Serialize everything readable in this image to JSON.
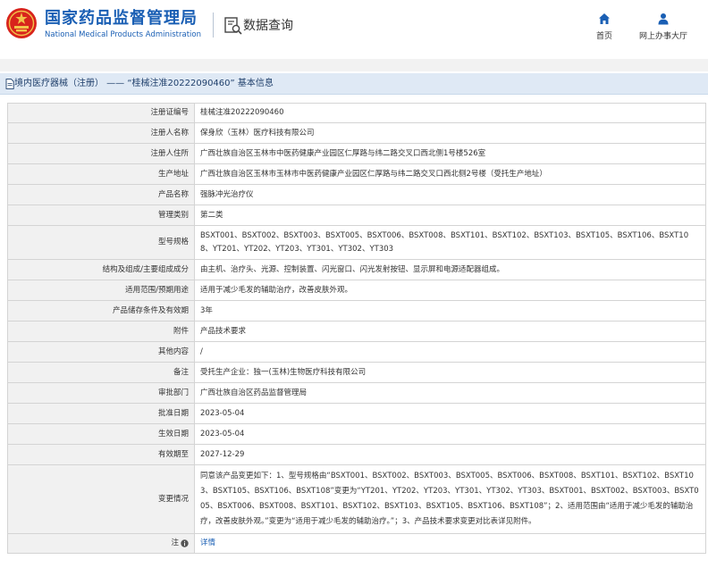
{
  "header": {
    "site_name_cn": "国家药品监督管理局",
    "site_name_en": "National Medical Products Administration",
    "section_title": "数据查询",
    "nav": [
      {
        "label": "首页",
        "icon": "home-icon"
      },
      {
        "label": "网上办事大厅",
        "icon": "user-icon"
      }
    ]
  },
  "colors": {
    "brand": "#1a5fb4",
    "title_bar_bg": "#dfe9f5",
    "label_cell_bg": "#f1f1f1",
    "logo_red": "#d8241c"
  },
  "title_bar": {
    "text": "境内医疗器械（注册） —— “桂械注准20222090460” 基本信息"
  },
  "rows": [
    {
      "label": "注册证编号",
      "value": "桂械注准20222090460"
    },
    {
      "label": "注册人名称",
      "value": "保身欣（玉林）医疗科技有限公司"
    },
    {
      "label": "注册人住所",
      "value": "广西壮族自治区玉林市中医药健康产业园区仁厚路与纬二路交叉口西北侧1号楼526室"
    },
    {
      "label": "生产地址",
      "value": "广西壮族自治区玉林市玉林市中医药健康产业园区仁厚路与纬二路交叉口西北侧2号楼（受托生产地址）"
    },
    {
      "label": "产品名称",
      "value": "强脉冲光治疗仪"
    },
    {
      "label": "管理类别",
      "value": "第二类"
    },
    {
      "label": "型号规格",
      "value": "BSXT001、BSXT002、BSXT003、BSXT005、BSXT006、BSXT008、BSXT101、BSXT102、BSXT103、BSXT105、BSXT106、BSXT108、YT201、YT202、YT203、YT301、YT302、YT303"
    },
    {
      "label": "结构及组成/主要组成成分",
      "value": "由主机、治疗头、光源、控制装置、闪光窗口、闪光发射按钮、显示屏和电源适配器组成。"
    },
    {
      "label": "适用范围/预期用途",
      "value": "适用于减少毛发的辅助治疗，改善皮肤外观。"
    },
    {
      "label": "产品储存条件及有效期",
      "value": "3年"
    },
    {
      "label": "附件",
      "value": "产品技术要求"
    },
    {
      "label": "其他内容",
      "value": "/"
    },
    {
      "label": "备注",
      "value": "受托生产企业：独一(玉林)生物医疗科技有限公司"
    },
    {
      "label": "审批部门",
      "value": "广西壮族自治区药品监督管理局"
    },
    {
      "label": "批准日期",
      "value": "2023-05-04"
    },
    {
      "label": "生效日期",
      "value": "2023-05-04"
    },
    {
      "label": "有效期至",
      "value": "2027-12-29"
    },
    {
      "label": "变更情况",
      "value": "同意该产品变更如下：1、型号规格由“BSXT001、BSXT002、BSXT003、BSXT005、BSXT006、BSXT008、BSXT101、BSXT102、BSXT103、BSXT105、BSXT106、BSXT108”变更为“YT201、YT202、YT203、YT301、YT302、YT303、BSXT001、BSXT002、BSXT003、BSXT005、BSXT006、BSXT008、BSXT101、BSXT102、BSXT103、BSXT105、BSXT106、BSXT108”；2、适用范围由“适用于减少毛发的辅助治疗，改善皮肤外观。”变更为“适用于减少毛发的辅助治疗。”；3、产品技术要求变更对比表详见附件。"
    },
    {
      "label": "注",
      "value": "详情",
      "label_icon": "info-icon"
    }
  ]
}
